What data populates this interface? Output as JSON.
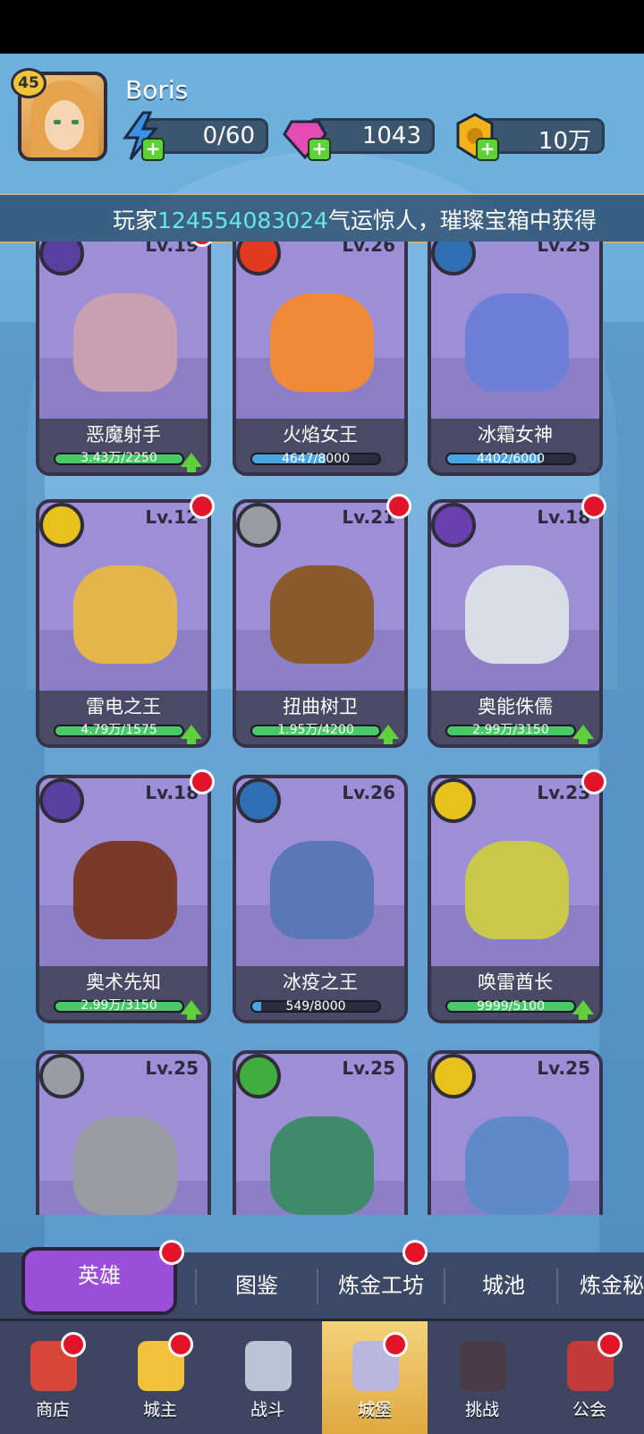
{
  "player": {
    "name": "Boris",
    "level": "45"
  },
  "resources": {
    "energy": "0/60",
    "gems": "1043",
    "gold": "10万"
  },
  "ticker": {
    "prefix": "玩家",
    "player_id": "124554083024",
    "suffix": "气运惊人，璀璨宝箱中获得"
  },
  "heroes": [
    {
      "name": "恶魔射手",
      "level": "Lv.19",
      "progress": "3.43万/2250",
      "upgrade": true,
      "badge": true,
      "element_icon": "bow-icon",
      "element_color": "#5b3f9e",
      "progress_fraction": 1.0
    },
    {
      "name": "火焰女王",
      "level": "Lv.26",
      "progress": "4647/8000",
      "upgrade": false,
      "badge": false,
      "element_icon": "fire-icon",
      "element_color": "#e23a1e",
      "progress_fraction": 0.58
    },
    {
      "name": "冰霜女神",
      "level": "Lv.25",
      "progress": "4402/6000",
      "upgrade": false,
      "badge": false,
      "element_icon": "ice-icon",
      "element_color": "#2f6fb3",
      "progress_fraction": 0.73
    },
    {
      "name": "雷电之王",
      "level": "Lv.12",
      "progress": "4.79万/1575",
      "upgrade": true,
      "badge": true,
      "element_icon": "lightning-icon",
      "element_color": "#e8c21c",
      "progress_fraction": 1.0
    },
    {
      "name": "扭曲树卫",
      "level": "Lv.21",
      "progress": "1.95万/4200",
      "upgrade": true,
      "badge": true,
      "element_icon": "armor-icon",
      "element_color": "#9a9aa2",
      "progress_fraction": 1.0
    },
    {
      "name": "奥能侏儒",
      "level": "Lv.18",
      "progress": "2.99万/3150",
      "upgrade": true,
      "badge": true,
      "element_icon": "arcane-icon",
      "element_color": "#6a3fb0",
      "progress_fraction": 1.0
    },
    {
      "name": "奥术先知",
      "level": "Lv.18",
      "progress": "2.99万/3150",
      "upgrade": true,
      "badge": true,
      "element_icon": "arrows-icon",
      "element_color": "#5b3f9e",
      "progress_fraction": 1.0
    },
    {
      "name": "冰疫之王",
      "level": "Lv.26",
      "progress": "549/8000",
      "upgrade": false,
      "badge": false,
      "element_icon": "crystal-icon",
      "element_color": "#2f6fb3",
      "progress_fraction": 0.07
    },
    {
      "name": "唤雷酋长",
      "level": "Lv.23",
      "progress": "9999/5100",
      "upgrade": true,
      "badge": true,
      "element_icon": "storm-icon",
      "element_color": "#e8c21c",
      "progress_fraction": 1.0
    },
    {
      "name": "",
      "level": "Lv.25",
      "progress": "",
      "upgrade": false,
      "badge": false,
      "element_icon": "rock-icon",
      "element_color": "#9a9aa2",
      "progress_fraction": 0
    },
    {
      "name": "",
      "level": "Lv.25",
      "progress": "",
      "upgrade": false,
      "badge": false,
      "element_icon": "wind-icon",
      "element_color": "#3fae3f",
      "progress_fraction": 0
    },
    {
      "name": "",
      "level": "Lv.25",
      "progress": "",
      "upgrade": false,
      "badge": false,
      "element_icon": "lightning-icon",
      "element_color": "#e8c21c",
      "progress_fraction": 0
    }
  ],
  "subtabs": [
    "英雄",
    "图鉴",
    "炼金工坊",
    "城池",
    "炼金秘"
  ],
  "nav": [
    "商店",
    "城主",
    "战斗",
    "城堡",
    "挑战",
    "公会"
  ]
}
